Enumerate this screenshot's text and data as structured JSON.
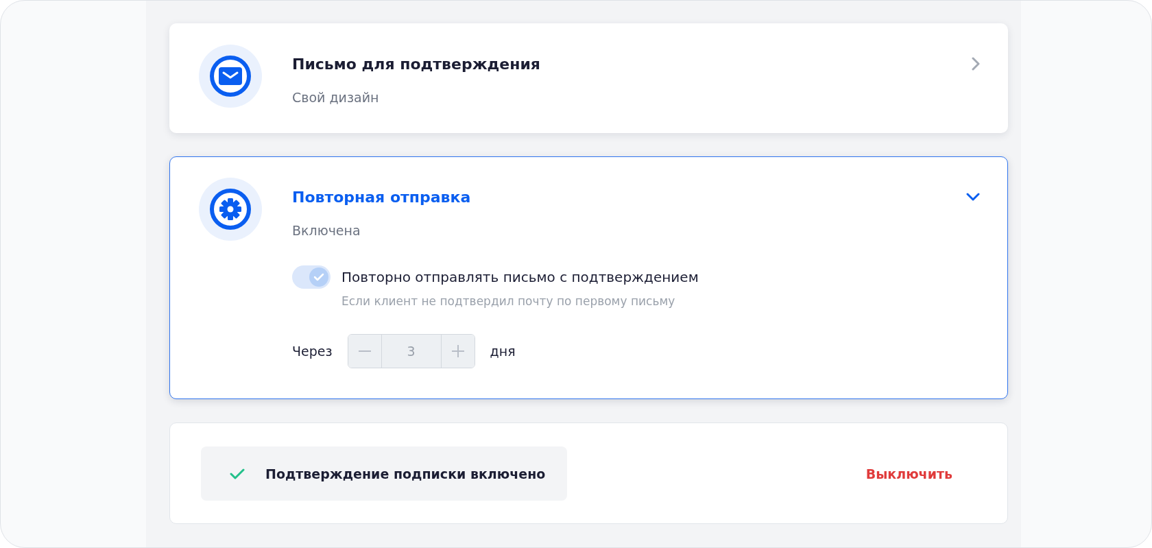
{
  "cards": [
    {
      "kind": "mail",
      "title": "Письмо для подтверждения",
      "subtitle": "Свой дизайн",
      "expanded": false
    },
    {
      "kind": "gear",
      "title": "Повторная отправка",
      "subtitle": "Включена",
      "expanded": true,
      "toggle": {
        "label": "Повторно отправлять письмо с подтверждением",
        "hint": "Если клиент не подтвердил почту по первому письму",
        "checked": true,
        "disabled": true
      },
      "delay": {
        "prefix": "Через",
        "value": "3",
        "suffix": "дня",
        "disabled": true
      }
    }
  ],
  "status": {
    "text": "Подтверждение подписки включено",
    "action": "Выключить"
  }
}
